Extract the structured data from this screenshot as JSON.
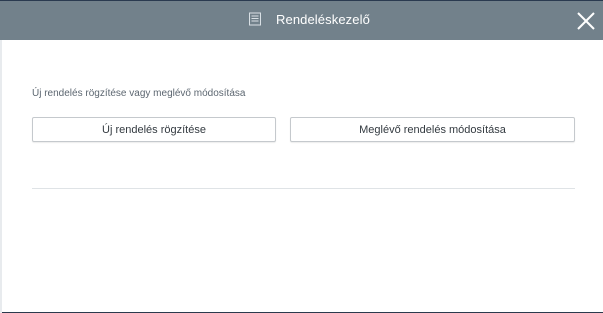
{
  "dialog": {
    "title": "Rendeléskezelő",
    "title_icon": "list-document-icon",
    "close_icon": "close-icon",
    "instruction": "Új rendelés rögzítése vagy meglévő módosítása",
    "buttons": {
      "new_order": "Új rendelés rögzítése",
      "modify_order": "Meglévő rendelés módosítása"
    }
  },
  "colors": {
    "header_bg": "#72818b",
    "dialog_bg": "#ffffff",
    "text": "#333a40",
    "border": "#c5c9cd"
  }
}
